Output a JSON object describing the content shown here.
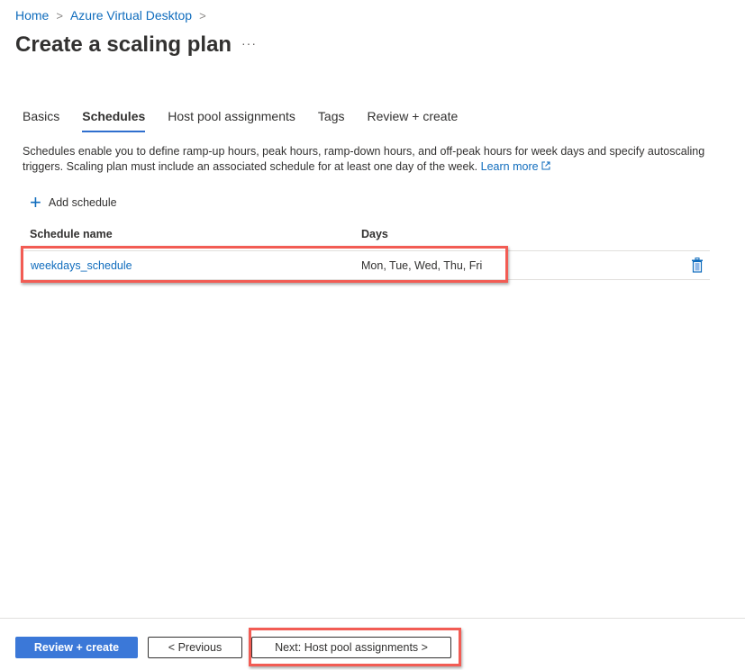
{
  "breadcrumb": {
    "items": [
      "Home",
      "Azure Virtual Desktop"
    ],
    "separator": ">"
  },
  "page": {
    "title": "Create a scaling plan",
    "more_label": "···"
  },
  "tabs": [
    {
      "label": "Basics",
      "active": false
    },
    {
      "label": "Schedules",
      "active": true
    },
    {
      "label": "Host pool assignments",
      "active": false
    },
    {
      "label": "Tags",
      "active": false
    },
    {
      "label": "Review + create",
      "active": false
    }
  ],
  "description": {
    "text": "Schedules enable you to define ramp-up hours, peak hours, ramp-down hours, and off-peak hours for week days and specify autoscaling triggers. Scaling plan must include an associated schedule for at least one day of the week.",
    "link": "Learn more"
  },
  "toolbar": {
    "add_schedule": "Add schedule"
  },
  "table": {
    "columns": [
      "Schedule name",
      "Days"
    ],
    "rows": [
      {
        "name": "weekdays_schedule",
        "days": "Mon, Tue, Wed, Thu, Fri",
        "action_icon": "trash-icon"
      }
    ]
  },
  "footer": {
    "review_create": "Review + create",
    "previous": "< Previous",
    "next": "Next: Host pool assignments >"
  },
  "colors": {
    "accent": "#0f6cbd",
    "primary_button": "#3b78d8",
    "highlight": "#f25c54"
  }
}
